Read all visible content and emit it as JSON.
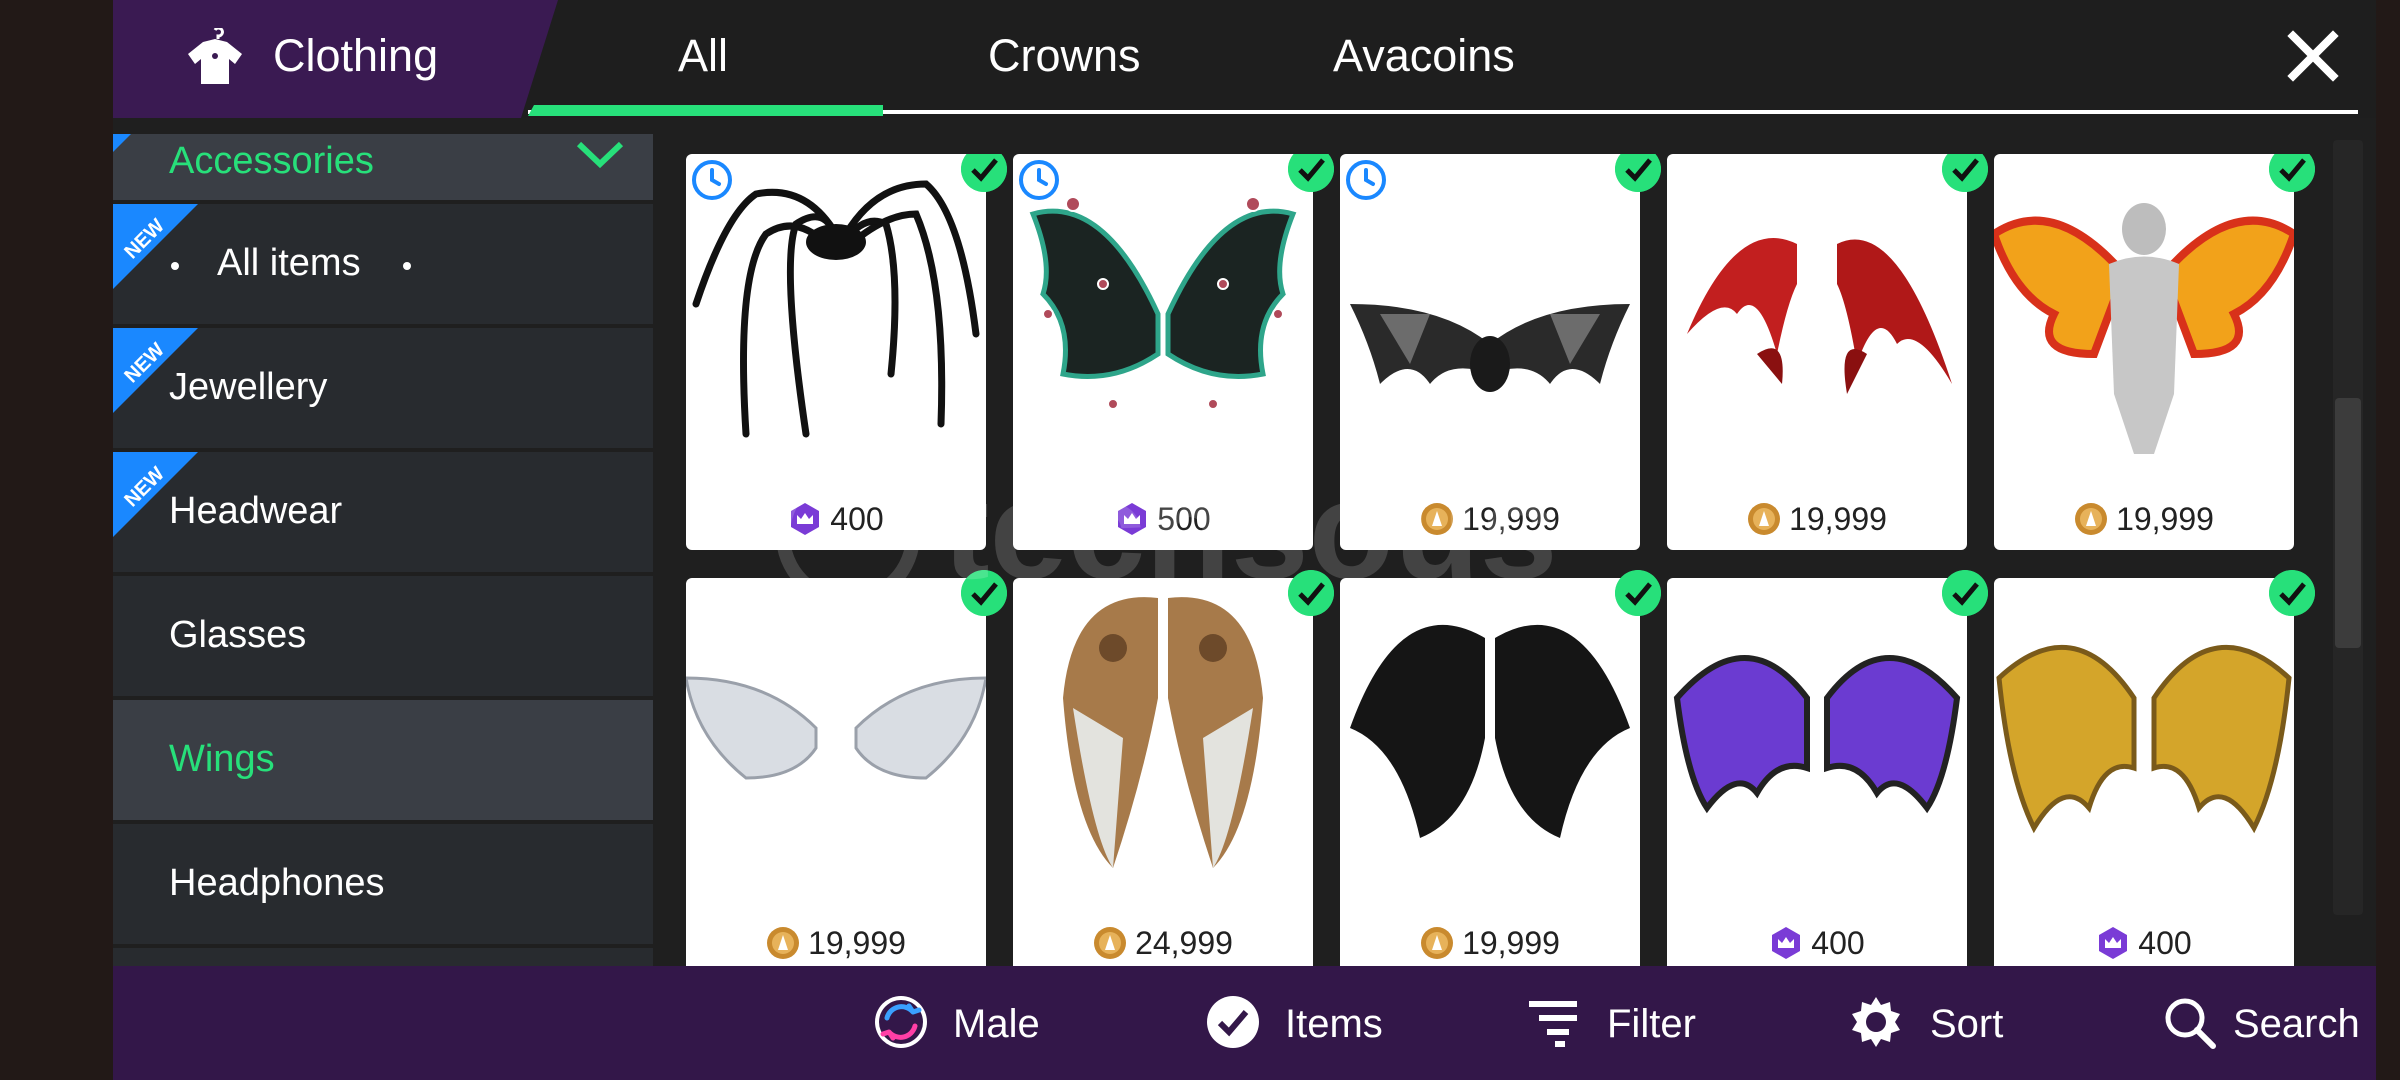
{
  "header": {
    "category_title": "Clothing",
    "tabs": [
      {
        "label": "All",
        "active": true
      },
      {
        "label": "Crowns",
        "active": false
      },
      {
        "label": "Avacoins",
        "active": false
      }
    ],
    "accent_color": "#27e07a",
    "brand_color": "#3a1a52"
  },
  "sidebar": {
    "items": [
      {
        "label": "Accessories",
        "state": "selected-parent",
        "new": false
      },
      {
        "label": "All items",
        "new": true
      },
      {
        "label": "Jewellery",
        "new": true
      },
      {
        "label": "Headwear",
        "new": true
      },
      {
        "label": "Glasses",
        "new": false
      },
      {
        "label": "Wings",
        "state": "selected",
        "new": false
      },
      {
        "label": "Headphones",
        "new": false
      }
    ],
    "new_badge": "NEW"
  },
  "items": [
    {
      "art": "spider-legs",
      "currency": "crowns",
      "price": "400",
      "timed": true,
      "owned": true
    },
    {
      "art": "dark-eye-wings",
      "currency": "crowns",
      "price": "500",
      "timed": true,
      "owned": true
    },
    {
      "art": "bat-wings",
      "currency": "avacoins",
      "price": "19,999",
      "timed": true,
      "owned": true
    },
    {
      "art": "red-demon-wings",
      "currency": "avacoins",
      "price": "19,999",
      "timed": false,
      "owned": true
    },
    {
      "art": "fire-wings",
      "currency": "avacoins",
      "price": "19,999",
      "timed": false,
      "owned": true
    },
    {
      "art": "white-angel-wings",
      "currency": "avacoins",
      "price": "19,999",
      "timed": false,
      "owned": true
    },
    {
      "art": "steampunk-wings",
      "currency": "avacoins",
      "price": "24,999",
      "timed": false,
      "owned": true
    },
    {
      "art": "black-feather-wings",
      "currency": "avacoins",
      "price": "19,999",
      "timed": false,
      "owned": true
    },
    {
      "art": "purple-dragon-wings",
      "currency": "crowns",
      "price": "400",
      "timed": false,
      "owned": true
    },
    {
      "art": "gold-dragon-wings",
      "currency": "crowns",
      "price": "400",
      "timed": false,
      "owned": true
    }
  ],
  "bottom_bar": {
    "male": "Male",
    "items": "Items",
    "filter": "Filter",
    "sort": "Sort",
    "search": "Search"
  },
  "watermark": "techsous"
}
